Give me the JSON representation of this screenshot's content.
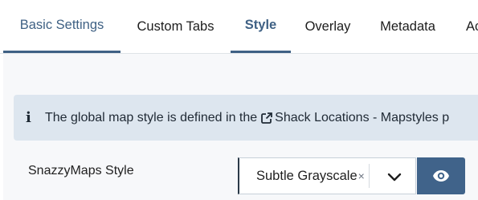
{
  "tabs": [
    {
      "label": "Basic Settings",
      "active": true
    },
    {
      "label": "Custom Tabs",
      "active": false
    },
    {
      "label": "Style",
      "active": true
    },
    {
      "label": "Overlay",
      "active": false
    },
    {
      "label": "Metadata",
      "active": false
    },
    {
      "label": "Ac",
      "active": false
    }
  ],
  "alert": {
    "icon": "info-icon",
    "text": "The global map style is defined in the",
    "link_icon": "external-link-icon",
    "link_text": "Shack Locations - Mapstyles p"
  },
  "field": {
    "label": "SnazzyMaps Style",
    "selected_value": "Subtle Grayscale",
    "clear_symbol": "×",
    "dropdown_icon": "chevron-down-icon",
    "preview_icon": "eye-icon"
  },
  "colors": {
    "accent": "#3f6184",
    "alert_bg": "#dde6ef",
    "button_bg": "#40638a"
  }
}
